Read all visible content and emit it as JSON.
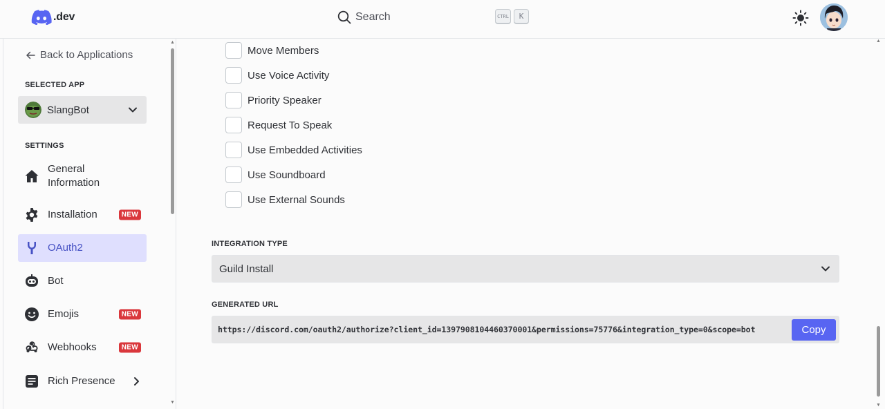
{
  "header": {
    "logo_text": ".dev",
    "search_label": "Search",
    "kbd_ctrl": "CTRL",
    "kbd_k": "K"
  },
  "sidebar": {
    "back_label": "Back to Applications",
    "selected_app_label": "SELECTED APP",
    "app_name": "SlangBot",
    "settings_label": "SETTINGS",
    "items": [
      {
        "label": "General Information",
        "icon": "home-icon"
      },
      {
        "label": "Installation",
        "icon": "gear-icon",
        "badge": "NEW"
      },
      {
        "label": "OAuth2",
        "icon": "wrench-icon",
        "active": true
      },
      {
        "label": "Bot",
        "icon": "bot-icon"
      },
      {
        "label": "Emojis",
        "icon": "emoji-icon",
        "badge": "NEW"
      },
      {
        "label": "Webhooks",
        "icon": "webhook-icon",
        "badge": "NEW"
      },
      {
        "label": "Rich Presence",
        "icon": "document-icon"
      }
    ]
  },
  "main": {
    "permissions": [
      "Move Members",
      "Use Voice Activity",
      "Priority Speaker",
      "Request To Speak",
      "Use Embedded Activities",
      "Use Soundboard",
      "Use External Sounds"
    ],
    "integration_type_label": "INTEGRATION TYPE",
    "integration_type_value": "Guild Install",
    "generated_url_label": "GENERATED URL",
    "generated_url": "https://discord.com/oauth2/authorize?client_id=1397908104460370001&permissions=75776&integration_type=0&scope=bot",
    "copy_label": "Copy"
  },
  "colors": {
    "accent": "#5865f2",
    "active_bg": "#dfdffe",
    "active_text": "#4752c4",
    "badge": "#da373c"
  }
}
